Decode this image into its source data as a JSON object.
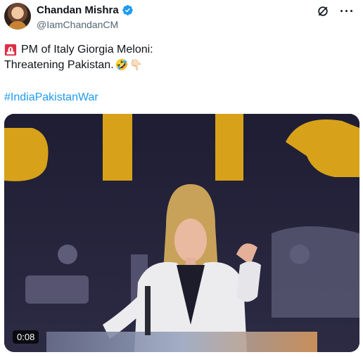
{
  "author": {
    "name": "Chandan Mishra",
    "handle": "@IamChandanCM",
    "verified": true
  },
  "icons": {
    "avatar": "avatar",
    "verified": "verified-badge-icon",
    "grok": "grok-icon",
    "more": "more-icon",
    "siren": "siren-icon"
  },
  "tweet": {
    "line1": "PM of Italy Giorgia Meloni:",
    "line2": "Threatening Pakistan.",
    "emoji1": "🤣",
    "emoji2": "👇🏻",
    "hashtag": "#IndiaPakistanWar"
  },
  "media": {
    "type": "video",
    "duration": "0:08"
  },
  "colors": {
    "link": "#1d9bf0",
    "verified": "#1d9bf0",
    "secondary_text": "#536471"
  }
}
